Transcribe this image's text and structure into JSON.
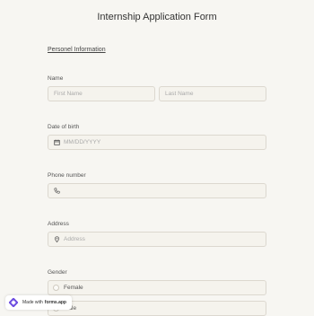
{
  "form": {
    "title": "Internship Application Form",
    "section_title": "Personel Information"
  },
  "fields": {
    "name": {
      "label": "Name",
      "first_placeholder": "First Name",
      "last_placeholder": "Last Name"
    },
    "dob": {
      "label": "Date of birth",
      "placeholder": "MM/DD/YYYY",
      "icon": "calendar-icon"
    },
    "phone": {
      "label": "Phone number",
      "placeholder": "",
      "icon": "phone-icon"
    },
    "address": {
      "label": "Address",
      "placeholder": "Address",
      "icon": "location-pin-icon"
    },
    "gender": {
      "label": "Gender",
      "options": [
        "Female",
        "Male"
      ]
    }
  },
  "badge": {
    "prefix": "Made with",
    "brand": "forms.app"
  },
  "colors": {
    "background": "#f7f6f2",
    "field_bg": "#f5f3ed",
    "field_border": "#dcd8cf",
    "brand": "#6c4ce0"
  }
}
